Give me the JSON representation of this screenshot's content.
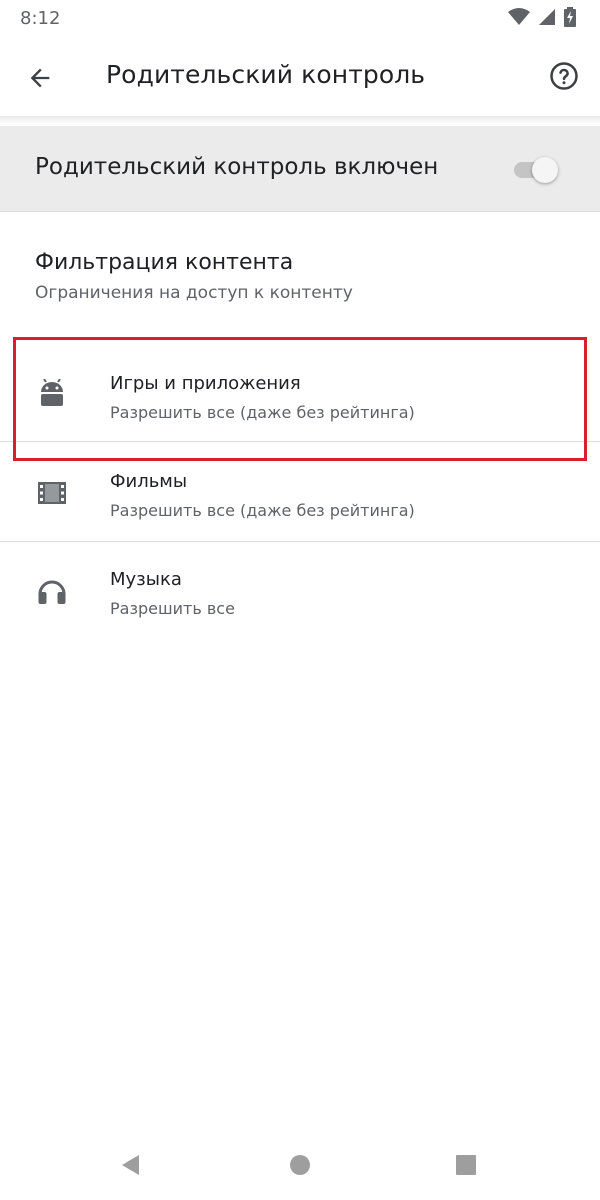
{
  "status_bar": {
    "time": "8:12"
  },
  "header": {
    "title": "Родительский контроль"
  },
  "master_switch": {
    "label": "Родительский контроль включен",
    "enabled": true
  },
  "content_filtering": {
    "title": "Фильтрация контента",
    "subtitle": "Ограничения на доступ к контенту"
  },
  "items": [
    {
      "icon": "android-icon",
      "title": "Игры и приложения",
      "subtitle": "Разрешить все (даже без рейтинга)",
      "highlighted": true
    },
    {
      "icon": "movie-icon",
      "title": "Фильмы",
      "subtitle": "Разрешить все (даже без рейтинга)"
    },
    {
      "icon": "headphones-icon",
      "title": "Музыка",
      "subtitle": "Разрешить все"
    }
  ],
  "colors": {
    "highlight": "#d7202e",
    "icon": "#5f6368",
    "switch_bar": "#ebebeb"
  }
}
